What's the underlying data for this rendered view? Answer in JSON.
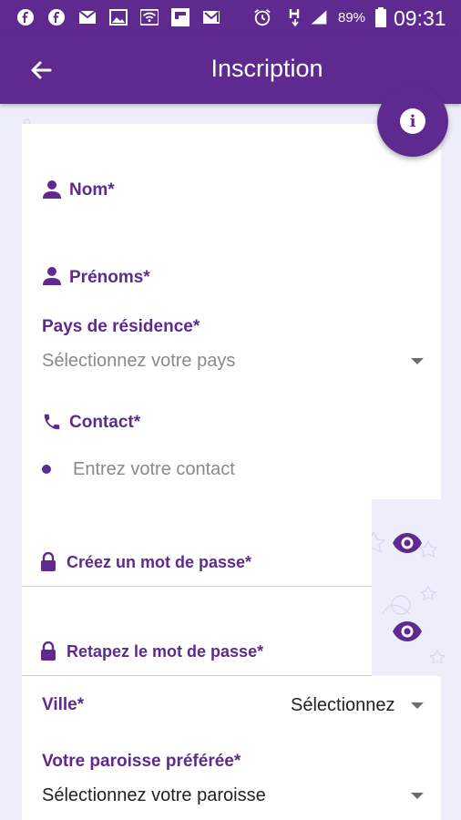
{
  "status_bar": {
    "battery": "89%",
    "time": "09:31",
    "icons": [
      "facebook-icon",
      "facebook-icon",
      "mail-icon",
      "image-icon",
      "wifi-icon",
      "flipboard-icon",
      "gmail-icon",
      "alarm-icon",
      "h-signal-icon",
      "signal-icon",
      "battery-icon"
    ]
  },
  "appbar": {
    "title": "Inscription",
    "back_icon": "arrow-left-icon"
  },
  "fab": {
    "icon": "info-icon",
    "glyph": "i"
  },
  "form": {
    "nom_label": "Nom*",
    "prenoms_label": "Prénoms*",
    "pays_label": "Pays de résidence*",
    "pays_placeholder": "Sélectionnez votre pays",
    "contact_label": "Contact*",
    "contact_placeholder": "Entrez votre contact",
    "password_label": "Créez un mot de passe*",
    "password_confirm_label": "Retapez le mot de passe*",
    "ville_label": "Ville*",
    "ville_value": "Sélectionnez",
    "paroisse_label": "Votre paroisse préférée*",
    "paroisse_value": "Sélectionnez votre paroisse"
  },
  "colors": {
    "primary": "#5f2a8f",
    "background": "#eeeefa"
  }
}
